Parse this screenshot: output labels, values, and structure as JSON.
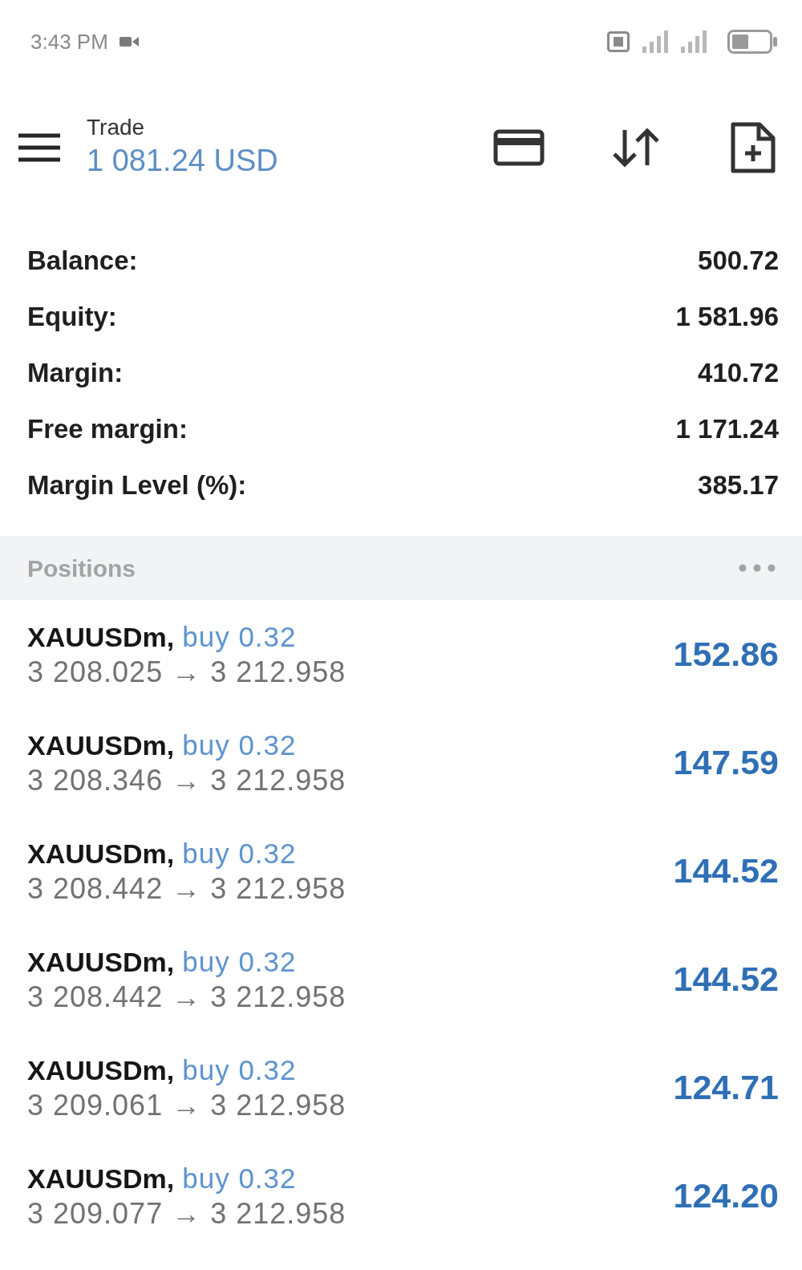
{
  "status_bar": {
    "time": "3:43 PM"
  },
  "toolbar": {
    "title": "Trade",
    "balance": "1 081.24 USD"
  },
  "summary": [
    {
      "label": "Balance:",
      "value": "500.72"
    },
    {
      "label": "Equity:",
      "value": "1 581.96"
    },
    {
      "label": "Margin:",
      "value": "410.72"
    },
    {
      "label": "Free margin:",
      "value": "1 171.24"
    },
    {
      "label": "Margin Level (%):",
      "value": "385.17"
    }
  ],
  "positions_header": {
    "title": "Positions"
  },
  "positions": [
    {
      "symbol": "XAUUSDm,",
      "order": "buy 0.32",
      "prices": "3 208.025 → 3 212.958",
      "profit": "152.86"
    },
    {
      "symbol": "XAUUSDm,",
      "order": "buy 0.32",
      "prices": "3 208.346 → 3 212.958",
      "profit": "147.59"
    },
    {
      "symbol": "XAUUSDm,",
      "order": "buy 0.32",
      "prices": "3 208.442 → 3 212.958",
      "profit": "144.52"
    },
    {
      "symbol": "XAUUSDm,",
      "order": "buy 0.32",
      "prices": "3 208.442 → 3 212.958",
      "profit": "144.52"
    },
    {
      "symbol": "XAUUSDm,",
      "order": "buy 0.32",
      "prices": "3 209.061 → 3 212.958",
      "profit": "124.71"
    },
    {
      "symbol": "XAUUSDm,",
      "order": "buy 0.32",
      "prices": "3 209.077 → 3 212.958",
      "profit": "124.20"
    }
  ]
}
